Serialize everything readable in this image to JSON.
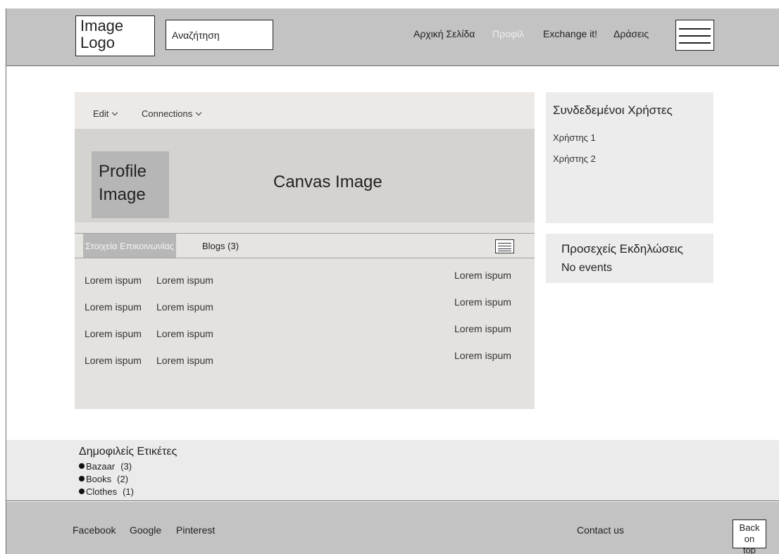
{
  "header": {
    "logo_line1": "Image",
    "logo_line2": "Logo",
    "search_placeholder": "Αναζήτηση",
    "nav": [
      "Αρχική Σελίδα",
      "Προφίλ",
      "Exchange it!",
      "Δράσεις"
    ],
    "active_nav": "Προφίλ",
    "menu_icon": "hamburger-icon"
  },
  "profile": {
    "menus": [
      "Edit",
      "Connections"
    ],
    "profile_image_line1": "Profile",
    "profile_image_line2": "Image",
    "canvas_label": "Canvas Image",
    "tabs": [
      "Στοιχεία Επικοινωνίας",
      "Blogs (3)"
    ],
    "active_tab": "Στοιχεία Επικοινωνίας",
    "rows": [
      [
        "Lorem ispum",
        "Lorem ispum",
        "Lorem ispum"
      ],
      [
        "Lorem ispum",
        "Lorem ispum",
        "Lorem ispum"
      ],
      [
        "Lorem ispum",
        "Lorem ispum",
        "Lorem ispum"
      ],
      [
        "Lorem ispum",
        "Lorem ispum",
        "Lorem ispum"
      ]
    ]
  },
  "connected_users": {
    "title": "Συνδεδεμένοι Χρήστες",
    "users": [
      "Χρήστης 1",
      "Χρήστης 2"
    ]
  },
  "events": {
    "title": "Προσεχείς Εκδηλώσεις",
    "status": "No events"
  },
  "tags": {
    "title": "Δημοφιλείς Ετικέτες",
    "items": [
      {
        "name": "Bazaar",
        "count": "(3)"
      },
      {
        "name": "Books",
        "count": "(2)"
      },
      {
        "name": "Clothes",
        "count": "(1)"
      }
    ]
  },
  "footer": {
    "social": [
      "Facebook",
      "Google",
      "Pinterest"
    ],
    "contact": "Contact us",
    "back_line1": "Back on",
    "back_line2": "top"
  },
  "colors": {
    "header_bg": "#c3c3c3",
    "active_nav": "#ededed",
    "card_bg": "#e4e2e0",
    "panel_bg": "#ececec"
  }
}
